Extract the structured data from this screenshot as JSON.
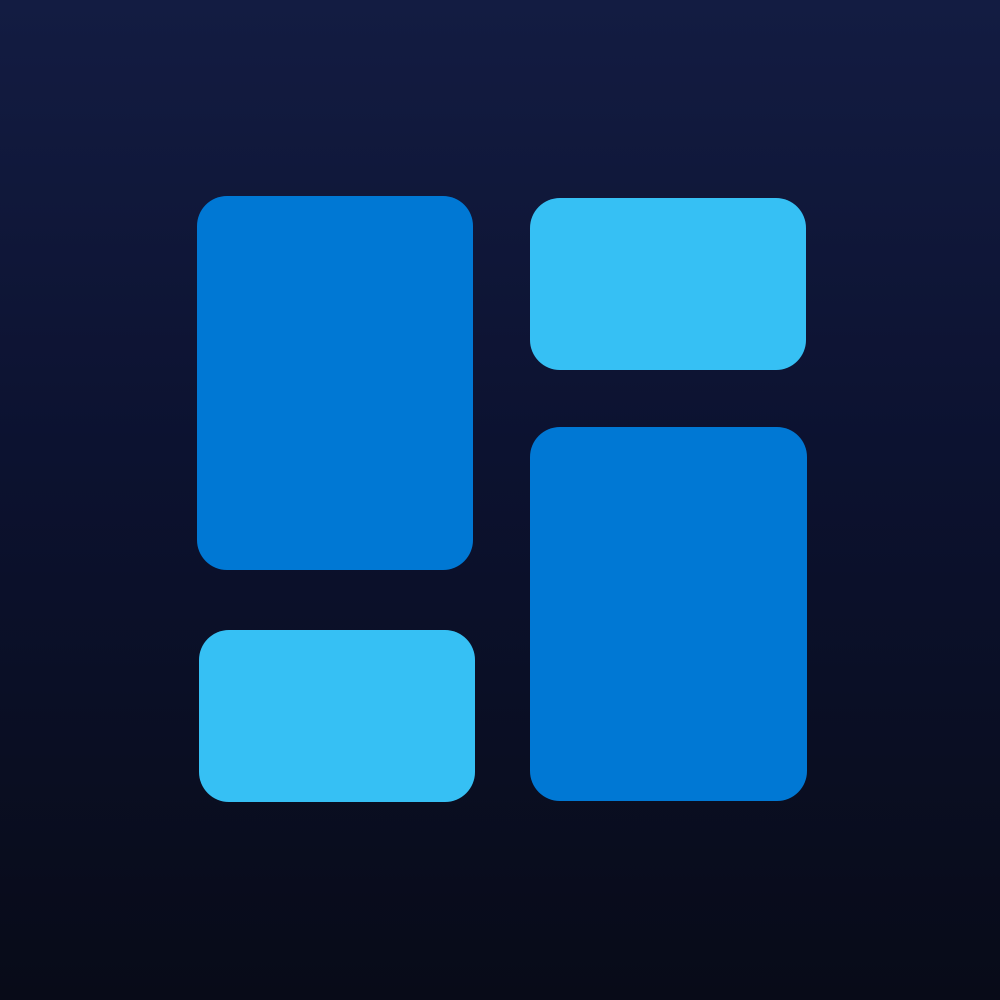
{
  "icon": {
    "name": "dashboard-layout-app-icon",
    "colors": {
      "background_top": "#131c42",
      "background_bottom": "#080b18",
      "tile_dark": "#0078d4",
      "tile_light": "#36c0f4"
    },
    "tiles": [
      {
        "name": "tile-top-left",
        "color": "tile_dark"
      },
      {
        "name": "tile-top-right",
        "color": "tile_light"
      },
      {
        "name": "tile-bottom-right",
        "color": "tile_dark"
      },
      {
        "name": "tile-bottom-left",
        "color": "tile_light"
      }
    ]
  }
}
